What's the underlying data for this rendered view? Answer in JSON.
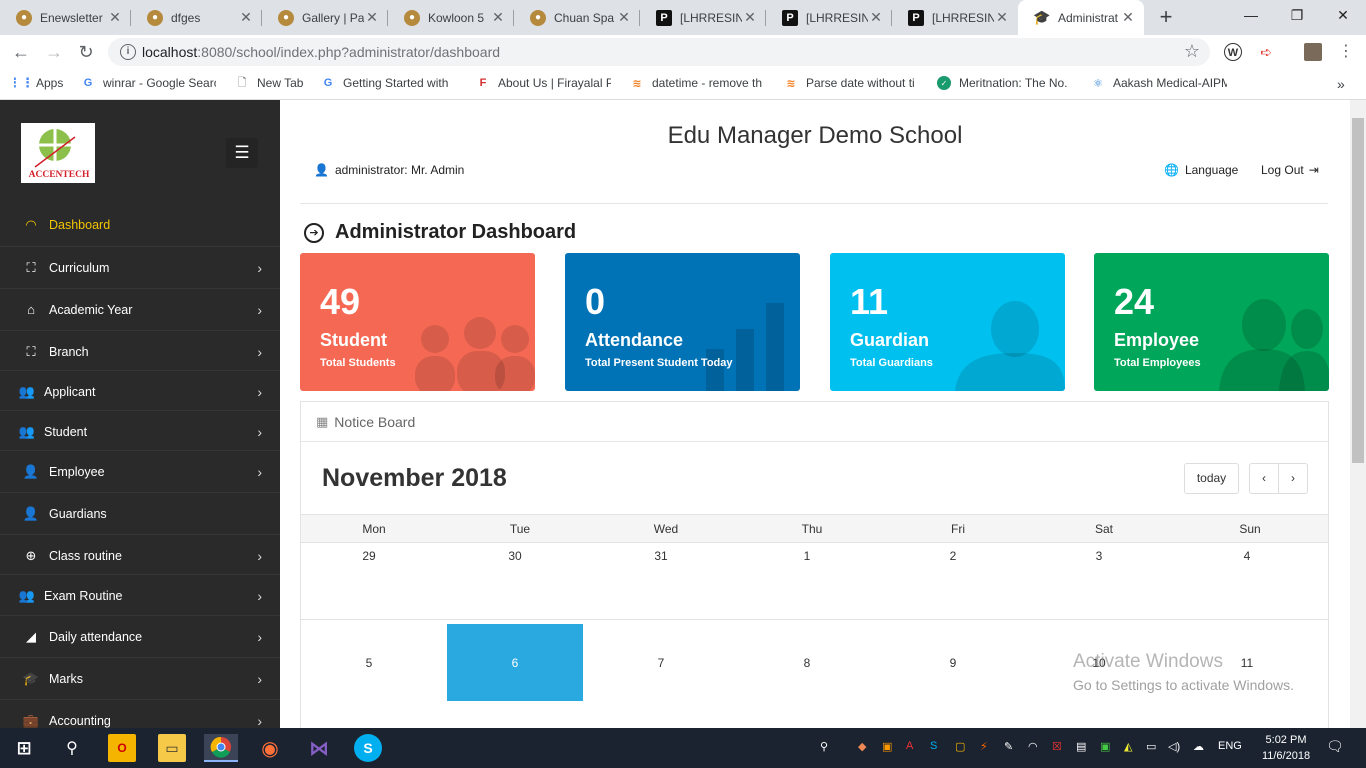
{
  "browser": {
    "tabs": [
      {
        "title": "Enewsletter",
        "icon": "ball-icon"
      },
      {
        "title": "dfges",
        "icon": "ball-icon"
      },
      {
        "title": "Gallery | Pat",
        "icon": "ball-icon"
      },
      {
        "title": "Kowloon 5",
        "icon": "ball-icon"
      },
      {
        "title": "Chuan Spa",
        "icon": "ball-icon"
      },
      {
        "title": "[LHRRESINT",
        "icon": "p-icon"
      },
      {
        "title": "[LHRRESINT",
        "icon": "p-icon"
      },
      {
        "title": "[LHRRESINT",
        "icon": "p-icon"
      },
      {
        "title": "Administrat",
        "icon": "graduation-cap-icon"
      }
    ],
    "url_host": "localhost",
    "url_rest": ":8080/school/index.php?administrator/dashboard",
    "bookmarks": [
      {
        "label": "Apps"
      },
      {
        "label": "winrar - Google Searc"
      },
      {
        "label": "New Tab"
      },
      {
        "label": "Getting Started with"
      },
      {
        "label": "About Us | Firayalal P"
      },
      {
        "label": "datetime - remove th"
      },
      {
        "label": "Parse date without ti"
      },
      {
        "label": "Meritnation: The No."
      },
      {
        "label": "Aakash Medical-AIPM"
      }
    ],
    "bookmarks_overflow": "»"
  },
  "sidebar": {
    "logo_text": "ACCENTECH",
    "items": [
      {
        "label": "Dashboard",
        "icon": "dashboard-icon",
        "active": true,
        "arrow": false
      },
      {
        "label": "Curriculum",
        "icon": "sitemap-icon",
        "arrow": true
      },
      {
        "label": "Academic Year",
        "icon": "home-icon",
        "arrow": true
      },
      {
        "label": "Branch",
        "icon": "sitemap-icon",
        "arrow": true
      },
      {
        "label": "Applicant",
        "icon": "users-icon",
        "arrow": true
      },
      {
        "label": "Student",
        "icon": "users-icon",
        "arrow": true
      },
      {
        "label": "Employee",
        "icon": "user-group-icon",
        "arrow": true
      },
      {
        "label": "Guardians",
        "icon": "user-icon",
        "arrow": false
      },
      {
        "label": "Class routine",
        "icon": "crosshair-icon",
        "arrow": true
      },
      {
        "label": "Exam Routine",
        "icon": "users-icon",
        "arrow": true
      },
      {
        "label": "Daily attendance",
        "icon": "chart-icon",
        "arrow": true
      },
      {
        "label": "Marks",
        "icon": "graduation-cap-icon",
        "arrow": true
      },
      {
        "label": "Accounting",
        "icon": "briefcase-icon",
        "arrow": true
      }
    ]
  },
  "header": {
    "school_name": "Edu Manager Demo School",
    "user": "administrator: Mr. Admin",
    "language": "Language",
    "logout": "Log Out"
  },
  "dashboard": {
    "title": "Administrator Dashboard",
    "cards": [
      {
        "value": "49",
        "label": "Student",
        "sub": "Total Students",
        "color": "#f56954",
        "icon": "users-icon"
      },
      {
        "value": "0",
        "label": "Attendance",
        "sub": "Total Present Student Today",
        "color": "#0073b7",
        "icon": "bar-chart-icon"
      },
      {
        "value": "11",
        "label": "Guardian",
        "sub": "Total Guardians",
        "color": "#00c0ef",
        "icon": "user-icon"
      },
      {
        "value": "24",
        "label": "Employee",
        "sub": "Total Employees",
        "color": "#00a65a",
        "icon": "user-group-icon"
      }
    ]
  },
  "calendar": {
    "panel_title": "Notice Board",
    "month_title": "November 2018",
    "today_label": "today",
    "prev": "‹",
    "next": "›",
    "weekdays": [
      "Mon",
      "Tue",
      "Wed",
      "Thu",
      "Fri",
      "Sat",
      "Sun"
    ],
    "weeks": [
      [
        "29",
        "30",
        "31",
        "1",
        "2",
        "3",
        "4"
      ],
      [
        "5",
        "6",
        "7",
        "8",
        "9",
        "10",
        "11"
      ]
    ],
    "highlight_color": "#29a9df"
  },
  "watermark": {
    "line1": "Activate Windows",
    "line2": "Go to Settings to activate Windows."
  },
  "taskbar": {
    "language": "ENG",
    "time": "5:02 PM",
    "date": "11/6/2018"
  }
}
